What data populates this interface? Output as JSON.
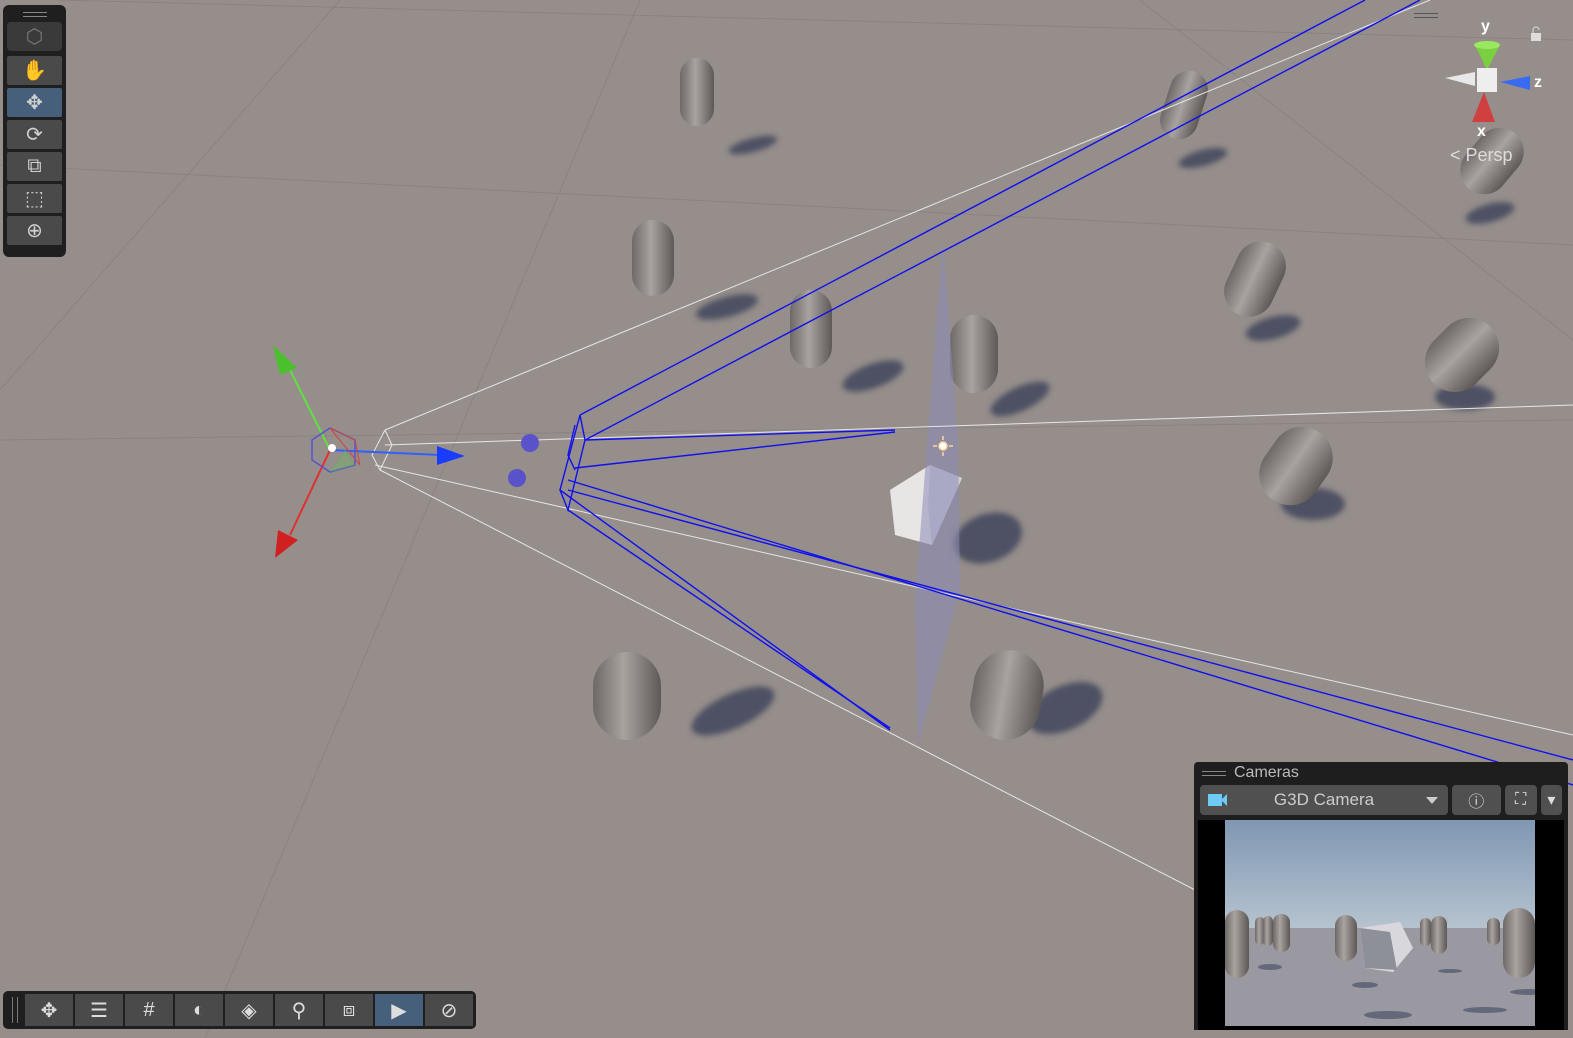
{
  "tools": [
    {
      "name": "view-cube",
      "icon": "cube-icon",
      "active": false
    },
    {
      "name": "hand",
      "icon": "hand-icon",
      "active": false
    },
    {
      "name": "move",
      "icon": "move-icon",
      "active": true
    },
    {
      "name": "rotate",
      "icon": "rotate-icon",
      "active": false
    },
    {
      "name": "scale",
      "icon": "scale-icon",
      "active": false
    },
    {
      "name": "rect",
      "icon": "rect-transform-icon",
      "active": false
    },
    {
      "name": "transform",
      "icon": "transform-icon",
      "active": false
    }
  ],
  "bottom_toolbar": [
    {
      "name": "move",
      "icon": "move-icon",
      "active": false
    },
    {
      "name": "settings",
      "icon": "sliders-icon",
      "active": false
    },
    {
      "name": "grid",
      "icon": "grid-icon",
      "active": false
    },
    {
      "name": "shading",
      "icon": "moon-icon",
      "active": false
    },
    {
      "name": "layers",
      "icon": "layer-plane-icon",
      "active": false
    },
    {
      "name": "search",
      "icon": "search-icon",
      "active": false
    },
    {
      "name": "pivot",
      "icon": "pivot-icon",
      "active": false
    },
    {
      "name": "camera-view",
      "icon": "camera-eye-icon",
      "active": true
    },
    {
      "name": "navigate",
      "icon": "compass-icon",
      "active": false
    }
  ],
  "gizmo": {
    "x": "x",
    "y": "y",
    "z": "z",
    "projection": "Persp"
  },
  "cameras": {
    "title": "Cameras",
    "selected": "G3D Camera"
  },
  "colors": {
    "accent": "#46607c",
    "frustum": "#0000ff",
    "background": "#968e8b"
  }
}
